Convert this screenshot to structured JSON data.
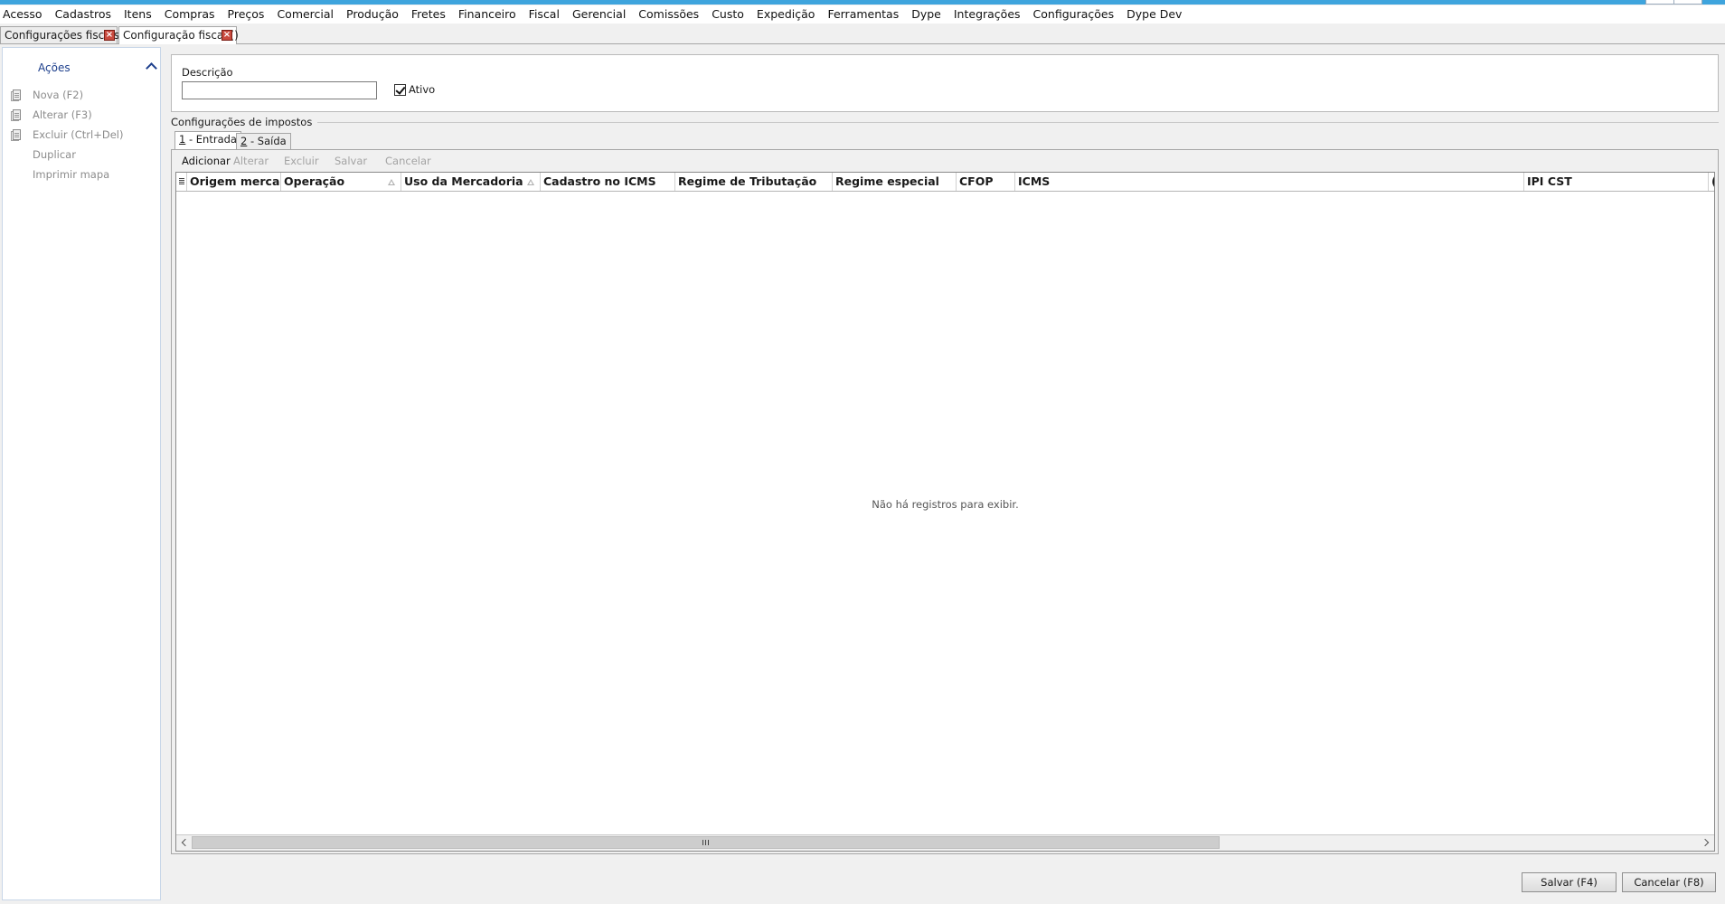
{
  "menu": [
    "Acesso",
    "Cadastros",
    "Itens",
    "Compras",
    "Preços",
    "Comercial",
    "Produção",
    "Fretes",
    "Financeiro",
    "Fiscal",
    "Gerencial",
    "Comissões",
    "Custo",
    "Expedição",
    "Ferramentas",
    "Dype",
    "Integrações",
    "Configurações",
    "Dype Dev"
  ],
  "doc_tabs": [
    {
      "label": "Configurações fiscais",
      "active": false
    },
    {
      "label": "Configuração fiscal ()",
      "active": true
    }
  ],
  "actions": {
    "title": "Ações",
    "items": [
      {
        "label": "Nova (F2)",
        "icon": "document-new-icon"
      },
      {
        "label": "Alterar (F3)",
        "icon": "document-edit-icon"
      },
      {
        "label": "Excluir (Ctrl+Del)",
        "icon": "document-delete-icon"
      },
      {
        "label": "Duplicar",
        "icon": ""
      },
      {
        "label": "Imprimir mapa",
        "icon": ""
      }
    ]
  },
  "form": {
    "descricao_label": "Descrição",
    "descricao_value": "",
    "ativo_label": "Ativo",
    "ativo_checked": true
  },
  "impostos": {
    "group_title": "Configurações de impostos",
    "tabs": [
      {
        "key": "1",
        "label": " - Entrada",
        "active": true
      },
      {
        "key": "2",
        "label": " - Saída",
        "active": false
      }
    ],
    "toolbar": {
      "adicionar": "Adicionar",
      "alterar": "Alterar",
      "excluir": "Excluir",
      "salvar": "Salvar",
      "cancelar": "Cancelar"
    },
    "columns": [
      "Origem mercad",
      "Operação",
      "Uso da Mercadoria",
      "Cadastro no ICMS",
      "Regime de Tributação",
      "Regime especial",
      "CFOP",
      "ICMS",
      "IPI CST",
      "("
    ],
    "empty_message": "Não há registros para exibir."
  },
  "footer": {
    "save_label": "Salvar (F4)",
    "cancel_label": "Cancelar (F8)"
  }
}
